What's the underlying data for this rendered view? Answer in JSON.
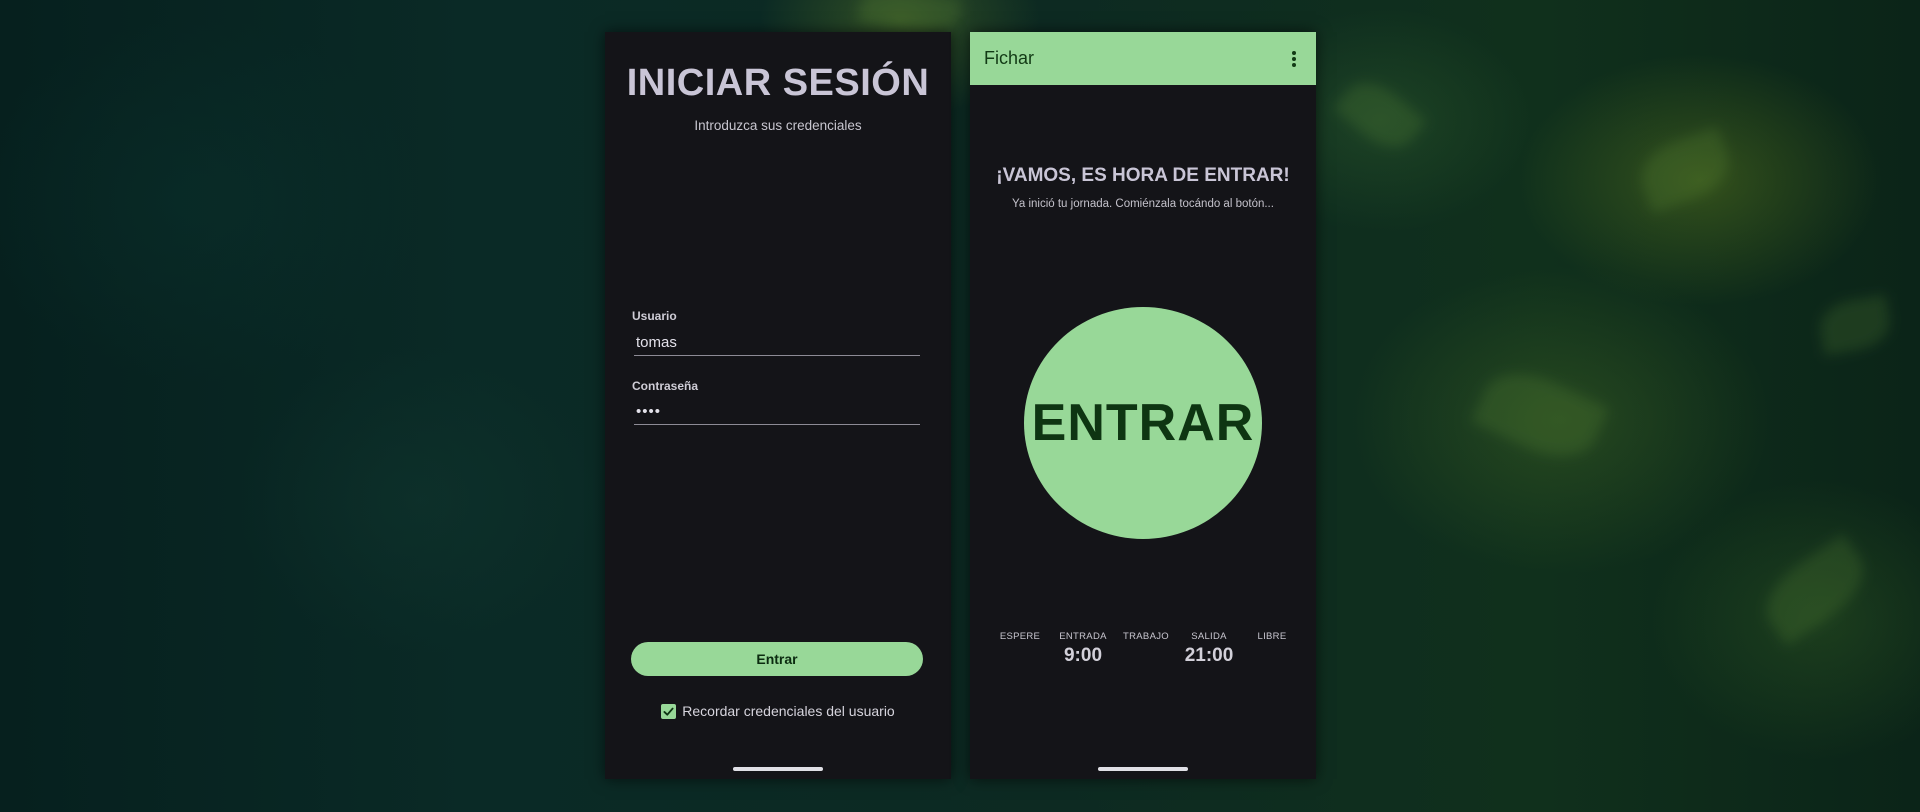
{
  "login": {
    "title": "INICIAR SESIÓN",
    "subtitle": "Introduzca sus credenciales",
    "username_label": "Usuario",
    "username_value": "tomas",
    "password_label": "Contraseña",
    "password_value": "••••",
    "submit_label": "Entrar",
    "remember_label": "Recordar credenciales del usuario",
    "remember_checked": true
  },
  "punch": {
    "appbar_title": "Fichar",
    "headline": "¡VAMOS, ES HORA DE ENTRAR!",
    "subline": "Ya inició tu jornada. Comiénzala tocándo al botón...",
    "main_button": "ENTRAR",
    "schedule": [
      {
        "label": "ESPERE",
        "time": ""
      },
      {
        "label": "ENTRADA",
        "time": "9:00"
      },
      {
        "label": "TRABAJO",
        "time": ""
      },
      {
        "label": "SALIDA",
        "time": "21:00"
      },
      {
        "label": "LIBRE",
        "time": ""
      }
    ]
  },
  "colors": {
    "accent": "#98d898",
    "surface": "#141418",
    "text_muted": "#c9c5d6"
  },
  "icons": {
    "checkbox": "check-icon",
    "menu": "more-vert-icon"
  }
}
